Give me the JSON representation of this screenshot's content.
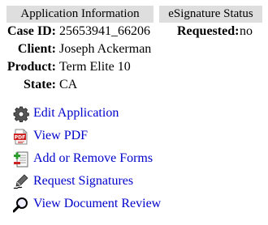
{
  "application_info": {
    "header": "Application Information",
    "fields": [
      {
        "label": "Case ID:",
        "value": "25653941_66206"
      },
      {
        "label": "Client:",
        "value": "Joseph Ackerman"
      },
      {
        "label": "Product:",
        "value": "Term Elite 10"
      },
      {
        "label": "State:",
        "value": "CA"
      }
    ]
  },
  "esignature": {
    "header": "eSignature Status",
    "label": "Requested:",
    "value": "no"
  },
  "actions": [
    {
      "label": "Edit Application",
      "icon": "gear-icon"
    },
    {
      "label": "View PDF",
      "icon": "pdf-icon"
    },
    {
      "label": "Add or Remove Forms",
      "icon": "add-remove-forms-icon"
    },
    {
      "label": "Request Signatures",
      "icon": "signature-pen-icon"
    },
    {
      "label": "View Document Review",
      "icon": "magnifier-icon"
    }
  ],
  "colors": {
    "header_background": "#dedede",
    "link": "#0000cc",
    "pdf_red": "#cc2222",
    "forms_green": "#2a9d2a"
  }
}
